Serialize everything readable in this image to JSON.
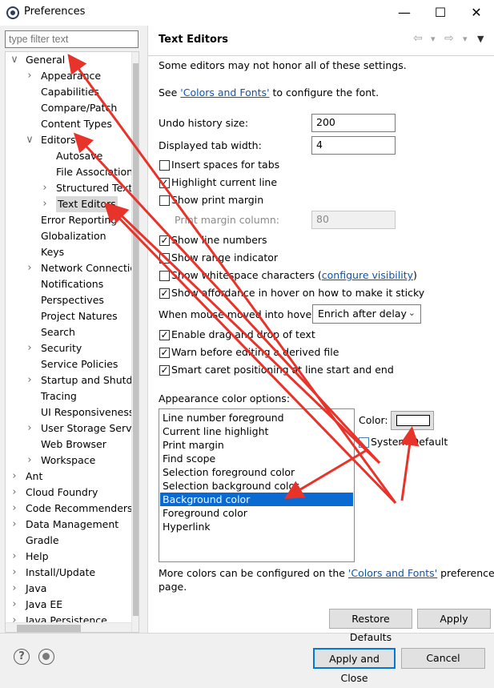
{
  "window": {
    "title": "Preferences",
    "controls": {
      "minimize": "—",
      "maximize": "☐",
      "close": "✕"
    }
  },
  "filter": {
    "placeholder": "type filter text"
  },
  "tree": [
    {
      "label": "General",
      "twisty": "open"
    },
    {
      "label": "Appearance",
      "twisty": "closed"
    },
    {
      "label": "Capabilities",
      "twisty": ""
    },
    {
      "label": "Compare/Patch",
      "twisty": ""
    },
    {
      "label": "Content Types",
      "twisty": ""
    },
    {
      "label": "Editors",
      "twisty": "open"
    },
    {
      "label": "Autosave",
      "twisty": ""
    },
    {
      "label": "File Associations",
      "twisty": ""
    },
    {
      "label": "Structured Text",
      "twisty": "closed"
    },
    {
      "label": "Text Editors",
      "twisty": "closed",
      "selected": true
    },
    {
      "label": "Error Reporting",
      "twisty": ""
    },
    {
      "label": "Globalization",
      "twisty": ""
    },
    {
      "label": "Keys",
      "twisty": ""
    },
    {
      "label": "Network Connections",
      "twisty": "closed"
    },
    {
      "label": "Notifications",
      "twisty": ""
    },
    {
      "label": "Perspectives",
      "twisty": ""
    },
    {
      "label": "Project Natures",
      "twisty": ""
    },
    {
      "label": "Search",
      "twisty": ""
    },
    {
      "label": "Security",
      "twisty": "closed"
    },
    {
      "label": "Service Policies",
      "twisty": ""
    },
    {
      "label": "Startup and Shutdown",
      "twisty": "closed"
    },
    {
      "label": "Tracing",
      "twisty": ""
    },
    {
      "label": "UI Responsiveness",
      "twisty": ""
    },
    {
      "label": "User Storage Service",
      "twisty": "closed"
    },
    {
      "label": "Web Browser",
      "twisty": ""
    },
    {
      "label": "Workspace",
      "twisty": "closed"
    },
    {
      "label": "Ant",
      "twisty": "closed"
    },
    {
      "label": "Cloud Foundry",
      "twisty": "closed"
    },
    {
      "label": "Code Recommenders",
      "twisty": "closed"
    },
    {
      "label": "Data Management",
      "twisty": "closed"
    },
    {
      "label": "Gradle",
      "twisty": ""
    },
    {
      "label": "Help",
      "twisty": "closed"
    },
    {
      "label": "Install/Update",
      "twisty": "closed"
    },
    {
      "label": "Java",
      "twisty": "closed"
    },
    {
      "label": "Java EE",
      "twisty": "closed"
    },
    {
      "label": "Java Persistence",
      "twisty": "closed"
    }
  ],
  "panel": {
    "title": "Text Editors",
    "nav_icons": {
      "back": "⇦",
      "back_menu": "▾",
      "forward": "⇨",
      "forward_menu": "▾",
      "view_menu": "▼"
    },
    "note": "Some editors may not honor all of these settings.",
    "see_prefix": "See ",
    "see_link": "'Colors and Fonts'",
    "see_suffix": " to configure the font.",
    "undo_label": "Undo history size:",
    "undo_value": "200",
    "tab_label": "Displayed tab width:",
    "tab_value": "4",
    "cb_insert_spaces": "Insert spaces for tabs",
    "cb_highlight_line": "Highlight current line",
    "cb_print_margin": "Show print margin",
    "print_margin_label": "Print margin column:",
    "print_margin_value": "80",
    "cb_line_numbers": "Show line numbers",
    "cb_range_indicator": "Show range indicator",
    "cb_whitespace": "Show whitespace characters (",
    "whitespace_link": "configure visibility",
    "whitespace_close": ")",
    "cb_affordance": "Show affordance in hover on how to make it sticky",
    "hover_label": "When mouse moved into hover:",
    "hover_value": "Enrich after delay",
    "cb_drag_drop": "Enable drag and drop of text",
    "cb_warn_derived": "Warn before editing a derived file",
    "cb_smart_caret": "Smart caret positioning at line start and end",
    "appearance_label": "Appearance color options:",
    "color_options": [
      "Line number foreground",
      "Current line highlight",
      "Print margin",
      "Find scope",
      "Selection foreground color",
      "Selection background color",
      "Background color",
      "Foreground color",
      "Hyperlink"
    ],
    "selected_color_option": "Background color",
    "color_label": "Color:",
    "system_default_label": "System Default",
    "more_colors_prefix": "More colors can be configured on the ",
    "more_colors_link": "'Colors and Fonts'",
    "more_colors_suffix": " preference",
    "more_colors_line2": "page.",
    "restore_defaults": "Restore Defaults",
    "apply": "Apply"
  },
  "checkbox_states": {
    "insert_spaces": false,
    "highlight_line": true,
    "print_margin": false,
    "line_numbers": true,
    "range_indicator": false,
    "whitespace": false,
    "affordance": true,
    "drag_drop": true,
    "warn_derived": true,
    "smart_caret": true,
    "system_default": false
  },
  "footer": {
    "help_icon": "?",
    "apply_and_close": "Apply and Close",
    "cancel": "Cancel"
  },
  "colors": {
    "annotation_red": "#e8332a",
    "selection_blue": "#0a6ad2",
    "link_blue": "#0b53b5"
  }
}
